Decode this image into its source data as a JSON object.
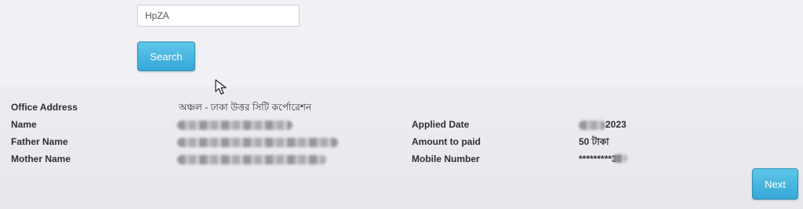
{
  "captcha": {
    "value": "HpZA"
  },
  "search": {
    "label": "Search"
  },
  "details": {
    "office_address": {
      "label": "Office Address",
      "value": "অঞ্চল - ঢাকা উত্তর সিটি কর্পোরেশন"
    },
    "name": {
      "label": "Name",
      "value": ""
    },
    "father_name": {
      "label": "Father Name",
      "value": ""
    },
    "mother_name": {
      "label": "Mother Name",
      "value": ""
    },
    "applied_date": {
      "label": "Applied Date",
      "value": "2023"
    },
    "amount_to_paid": {
      "label": "Amount to paid",
      "value": "50 টাকা"
    },
    "mobile_number": {
      "label": "Mobile Number",
      "value": "*********39"
    }
  },
  "next": {
    "label": "Next"
  },
  "colors": {
    "button_blue": "#36a7d6",
    "text": "#2f2f2f"
  }
}
